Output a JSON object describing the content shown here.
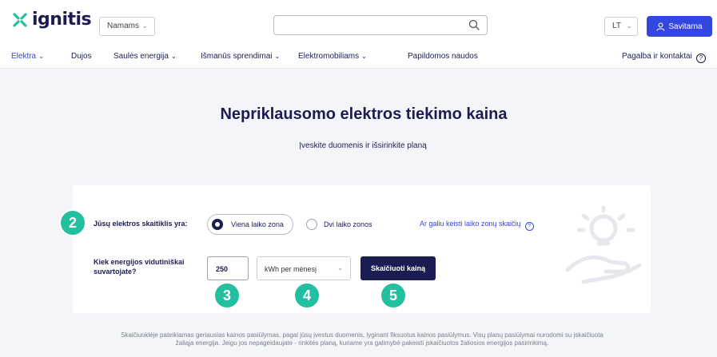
{
  "header": {
    "logo_text": "ignitis",
    "audience_select": "Namams",
    "search": {
      "value": "",
      "placeholder": ""
    },
    "language": "LT",
    "account_button": "Savitarna"
  },
  "nav": {
    "items": [
      {
        "label": "Elektra",
        "dropdown": true,
        "active": true
      },
      {
        "label": "Dujos",
        "dropdown": false,
        "active": false
      },
      {
        "label": "Saulės energija",
        "dropdown": true,
        "active": false
      },
      {
        "label": "Išmanūs sprendimai",
        "dropdown": true,
        "active": false
      },
      {
        "label": "Elektromobiliams",
        "dropdown": true,
        "active": false
      },
      {
        "label": "Papildomos naudos",
        "dropdown": false,
        "active": false
      }
    ],
    "help_link": "Pagalba ir kontaktai"
  },
  "hero": {
    "title": "Nepriklausomo elektros tiekimo kaina",
    "subtitle": "Įveskite duomenis ir išsirinkite planą"
  },
  "calculator": {
    "meter_label": "Jūsų elektros skaitiklis yra:",
    "options": [
      {
        "label": "Viena laiko zona",
        "selected": true
      },
      {
        "label": "Dvi laiko zonos",
        "selected": false
      }
    ],
    "zones_link": "Ar galiu keisti laiko zonų skaičių",
    "usage_label": "Kiek energijos vidutiniškai suvartojate?",
    "usage_value": "250",
    "unit": "kWh per mėnesį",
    "calculate_button": "Skaičiuoti kainą"
  },
  "steps": [
    "2",
    "3",
    "4",
    "5"
  ],
  "disclaimer": "Skaičiuoklėje pateikiamas geriausias kainos pasiūlymas, pagal jūsų įvestus duomenis, lyginant fiksuotus kainos pasiūlymus. Visų planų pasiūlymai nurodomi su įskaičiuota žaliąja energija. Jeigu jos nepageidaujate - rinkitės planą, kuriame yra galimybė pakeisti įskaičiuotos žaliosios energijos pasirinkimą.",
  "colors": {
    "brand_blue": "#3346e0",
    "navy": "#1b1d52",
    "step_badge": "#23c0a0",
    "page_bg": "#f4f5f8"
  },
  "icons": [
    "ignitis-logo-icon",
    "search-icon",
    "user-icon",
    "chevron-down-icon",
    "help-icon",
    "lightbulb-hand-icon"
  ]
}
